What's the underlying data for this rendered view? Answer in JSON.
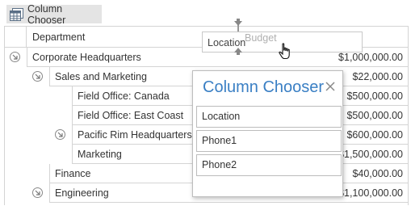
{
  "toolbar": {
    "column_chooser_label": "Column Chooser"
  },
  "grid": {
    "header": {
      "department": "Department"
    },
    "rows": [
      {
        "label": "Corporate Headquarters",
        "value": "$1,000,000.00",
        "level": 0,
        "has_expander": true
      },
      {
        "label": "Sales and Marketing",
        "value": "$22,000.00",
        "level": 1,
        "has_expander": true
      },
      {
        "label": "Field Office: Canada",
        "value": "$500,000.00",
        "level": 2,
        "has_expander": false
      },
      {
        "label": "Field Office: East Coast",
        "value": "$500,000.00",
        "level": 2,
        "has_expander": false
      },
      {
        "label": "Pacific Rim Headquarters",
        "value": "$600,000.00",
        "level": 2,
        "has_expander": true
      },
      {
        "label": "Marketing",
        "value": "$1,500,000.00",
        "level": 2,
        "has_expander": false
      },
      {
        "label": "Finance",
        "value": "$40,000.00",
        "level": 1,
        "has_expander": false
      },
      {
        "label": "Engineering",
        "value": "$1,100,000.00",
        "level": 1,
        "has_expander": true
      }
    ]
  },
  "drag": {
    "location_label": "Location",
    "budget_label": "Budget"
  },
  "chooser": {
    "title": "Column Chooser",
    "items": [
      "Location",
      "Phone1",
      "Phone2"
    ]
  },
  "colors": {
    "accent": "#3a7fc4",
    "border": "#d4d4d4",
    "toolbar_bg": "#e4e4e4"
  }
}
